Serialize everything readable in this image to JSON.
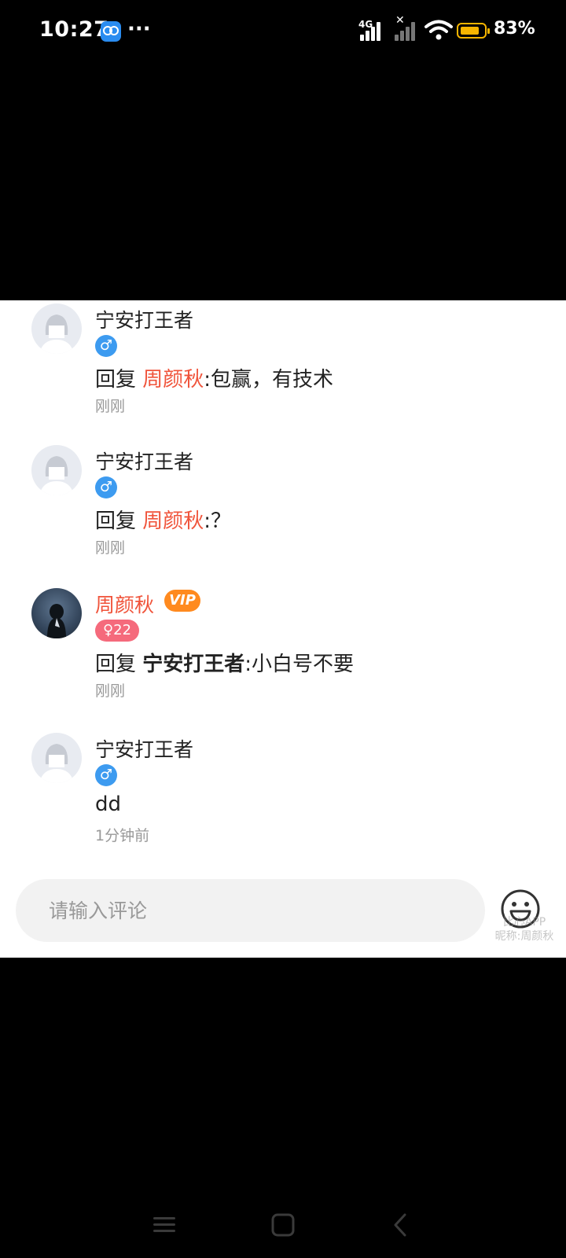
{
  "status_bar": {
    "time": "10:27",
    "dots": "···",
    "network": "4G",
    "battery_percent": "83%",
    "battery_level": 0.83
  },
  "comments": [
    {
      "username": "宁安打王者",
      "gender": "male",
      "gender_symbol": "♂",
      "age": "",
      "prefix": "回复 ",
      "reply_to": "周颜秋",
      "body": ":包赢，有技术",
      "time": "刚刚"
    },
    {
      "username": "宁安打王者",
      "gender": "male",
      "gender_symbol": "♂",
      "age": "",
      "prefix": "回复 ",
      "reply_to": "周颜秋",
      "body": ":？",
      "time": "刚刚"
    },
    {
      "username": "周颜秋",
      "vip": "VIP",
      "gender": "female",
      "gender_symbol": "♀",
      "age": "22",
      "prefix": "回复 ",
      "reply_to": "宁安打王者",
      "body": ":小白号不要",
      "time": "刚刚"
    },
    {
      "username": "宁安打王者",
      "gender": "male",
      "gender_symbol": "♂",
      "age": "",
      "prefix": "",
      "reply_to": "",
      "body": "dd",
      "time": "1分钟前"
    }
  ],
  "comment_input": {
    "placeholder": "请输入评论"
  },
  "watermark": {
    "line1": "比心APP",
    "line2": "昵称:周颜秋"
  },
  "colors": {
    "accent_name": "#f0533a",
    "vip_badge": "#ff8a1f",
    "male": "#3d9bf0",
    "female": "#f56a7c"
  }
}
